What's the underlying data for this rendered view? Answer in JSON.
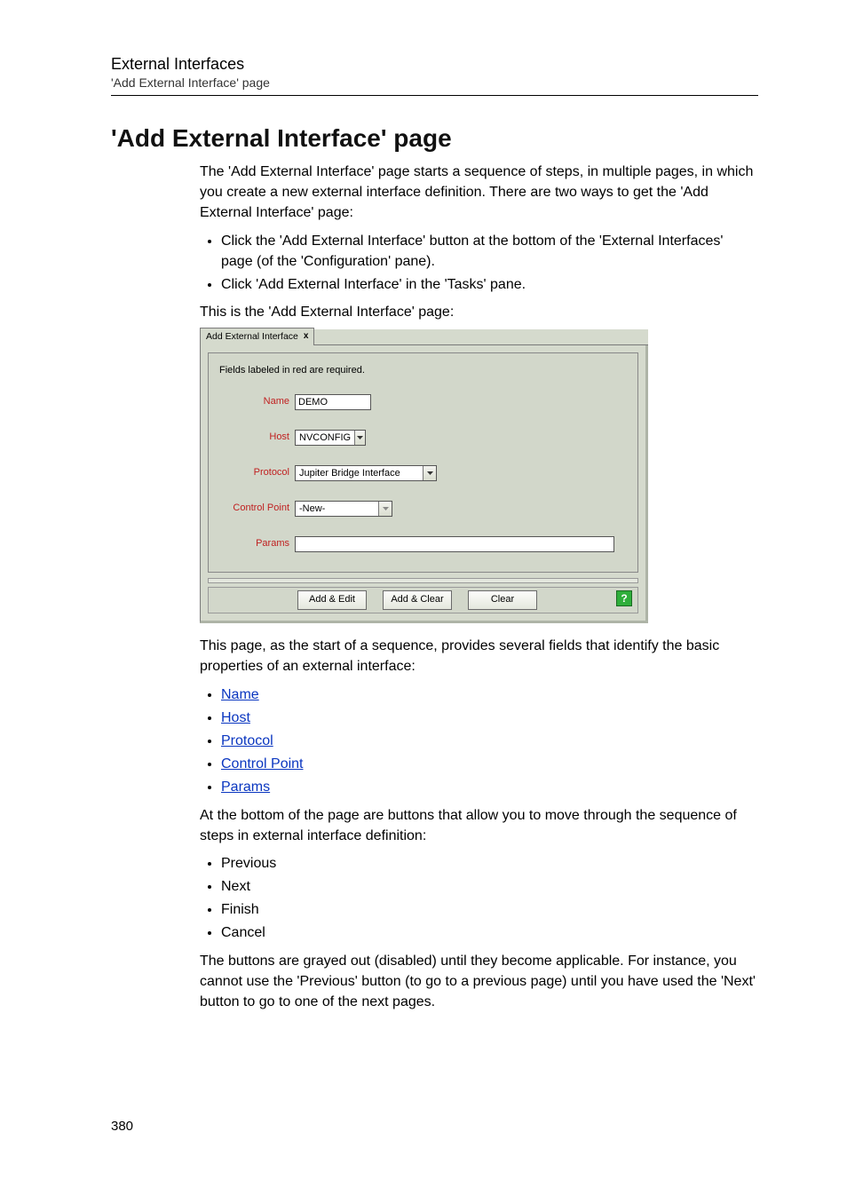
{
  "header": {
    "chapter": "External Interfaces",
    "subtitle": "'Add External Interface' page"
  },
  "section_title": "'Add External Interface' page",
  "intro_para": "The 'Add External Interface' page starts a sequence of steps, in multiple pages, in which you create a new external interface definition. There are two ways to get the 'Add External Interface' page:",
  "intro_bullets": [
    "Click the 'Add External Interface' button at the bottom of the 'External Interfaces' page (of the 'Configuration' pane).",
    "Click 'Add External Interface' in the 'Tasks' pane."
  ],
  "fig_lead_in": "This is the 'Add External Interface' page:",
  "figure": {
    "tab_label": "Add External Interface",
    "required_note": "Fields labeled in red are required.",
    "fields": {
      "name": {
        "label": "Name",
        "value": "DEMO"
      },
      "host": {
        "label": "Host",
        "value": "NVCONFIG"
      },
      "protocol": {
        "label": "Protocol",
        "value": "Jupiter Bridge Interface"
      },
      "control_point": {
        "label": "Control Point",
        "value": "-New-"
      },
      "params": {
        "label": "Params",
        "value": ""
      }
    },
    "buttons": {
      "add_edit": "Add & Edit",
      "add_clear": "Add & Clear",
      "clear": "Clear",
      "help": "?"
    }
  },
  "after_fig_para": "This page, as the start of a sequence, provides several fields that identify the basic properties of an external interface:",
  "link_bullets": [
    "Name",
    "Host",
    "Protocol",
    "Control Point",
    "Params"
  ],
  "buttons_para": "At the bottom of the page are buttons that allow you to move through the sequence of steps in external interface definition:",
  "button_bullets": [
    "Previous",
    "Next",
    "Finish",
    "Cancel"
  ],
  "closing_para": "The buttons are grayed out (disabled) until they become applicable. For instance, you cannot use the 'Previous' button (to go to a previous page) until you have used the 'Next' button to go to one of the next pages.",
  "page_number": "380"
}
